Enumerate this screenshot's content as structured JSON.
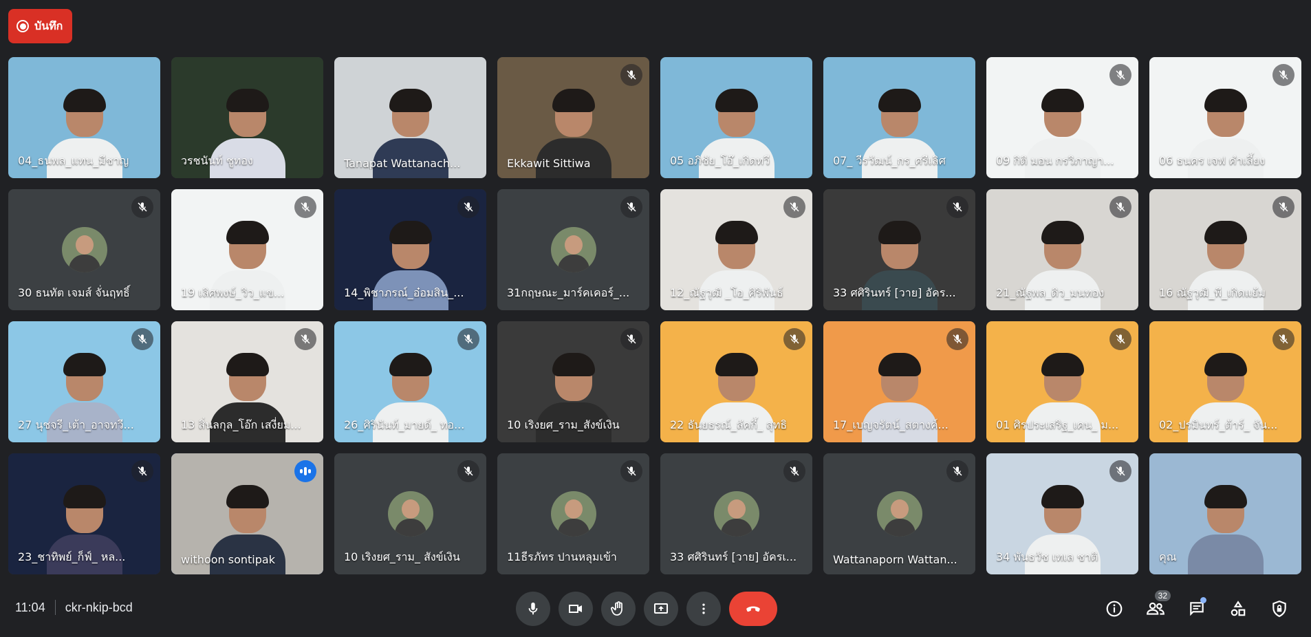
{
  "recording": {
    "label": "บันทึก"
  },
  "participants": [
    {
      "name": "04_ธนพล_แทน_มีชาญ",
      "muted": false,
      "kind": "video",
      "bg": "#7fb8d8",
      "shirt": "#eef0f0"
    },
    {
      "name": "วรชนันท์ ชูทอง",
      "muted": false,
      "kind": "video",
      "bg": "#2b3a2b",
      "shirt": "#d9dce6"
    },
    {
      "name": "Tanapat Wattanach...",
      "muted": false,
      "kind": "video",
      "bg": "#cfd3d6",
      "shirt": "#2f3b55"
    },
    {
      "name": "Ekkawit Sittiwa",
      "muted": true,
      "kind": "video",
      "bg": "#6a5a45",
      "shirt": "#2c2c2c"
    },
    {
      "name": "05 อภิชัย_โอ๊_เกิดทวี",
      "muted": false,
      "kind": "video",
      "bg": "#7fb8d8",
      "shirt": "#eef0f0"
    },
    {
      "name": "07_ วีรวัฒน์_กร_ศรีเลิศ",
      "muted": false,
      "kind": "video",
      "bg": "#7fb8d8",
      "shirt": "#eef0f0"
    },
    {
      "name": "09 กิติ มอน กรวิภาญา...",
      "muted": true,
      "kind": "video",
      "bg": "#f2f4f4",
      "shirt": "#eef0f0"
    },
    {
      "name": "06 ธนคร เจฟ คำเลี้ยง",
      "muted": true,
      "kind": "video",
      "bg": "#f2f4f4",
      "shirt": "#eef0f0"
    },
    {
      "name": "30 ธนทัต เจมส์ จั่นฤทธิ์",
      "muted": true,
      "kind": "avatar",
      "bg": "#3c4043"
    },
    {
      "name": "19 เลิศพงษ์_วิว_แข...",
      "muted": true,
      "kind": "video",
      "bg": "#f2f4f4",
      "shirt": "#eef0f0"
    },
    {
      "name": "14_พิชาภรณ์_อ๋อมสิน_...",
      "muted": true,
      "kind": "video",
      "bg": "#1a2440",
      "shirt": "#7d92b8"
    },
    {
      "name": "31กฤษณะ_มาร์คเคอร์_...",
      "muted": true,
      "kind": "avatar",
      "bg": "#3c4043"
    },
    {
      "name": "12_ณัฐวุฒิ _โอ_ศิริพันธ์",
      "muted": true,
      "kind": "video",
      "bg": "#e4e2de",
      "shirt": "#eef0f0"
    },
    {
      "name": "33 ศศิรินทร์ [วาย] อัคร...",
      "muted": true,
      "kind": "video",
      "bg": "#3a3a3a",
      "shirt": "#3a4a4f"
    },
    {
      "name": "21_ณัฐพล_ดิว_มนทอง",
      "muted": true,
      "kind": "video",
      "bg": "#d8d6d2",
      "shirt": "#eef0f0"
    },
    {
      "name": "16 ณัฐวุฒิ_พี_เกิดแย้ม",
      "muted": true,
      "kind": "video",
      "bg": "#d8d6d2",
      "shirt": "#eef0f0"
    },
    {
      "name": "27 นุชจรี_เต้า_อาจทวี...",
      "muted": true,
      "kind": "video",
      "bg": "#8cc7e6",
      "shirt": "#a8b3c9"
    },
    {
      "name": "13 สิ่นลกุล_โอ๊ก เสงี่ยม...",
      "muted": true,
      "kind": "video",
      "bg": "#e4e2de",
      "shirt": "#2c2c2c"
    },
    {
      "name": "26_ศิรินันท์_มายด์_ ทอ...",
      "muted": true,
      "kind": "video",
      "bg": "#8cc7e6",
      "shirt": "#eef0f0"
    },
    {
      "name": "10 เริงยศ_ราม_สังข์เงิน",
      "muted": true,
      "kind": "video",
      "bg": "#3a3a3a",
      "shirt": "#2c2c2c"
    },
    {
      "name": "22 ธันยธรณ์_ลัคกี้_ สุทธิ",
      "muted": true,
      "kind": "video",
      "bg": "#f4b24a",
      "shirt": "#eef0f0"
    },
    {
      "name": "17_เบญจรัตน์_สตางค์...",
      "muted": true,
      "kind": "video",
      "bg": "#f09a4a",
      "shirt": "#d7dbe4"
    },
    {
      "name": "01 ศิรประเสริฐ_เคน_ ม...",
      "muted": true,
      "kind": "video",
      "bg": "#f4b24a",
      "shirt": "#eef0f0"
    },
    {
      "name": "02_ปรมินทร์_ต้าร์_ จัน...",
      "muted": true,
      "kind": "video",
      "bg": "#f4b24a",
      "shirt": "#eef0f0"
    },
    {
      "name": "23_ชาทิพย์_ก็ฟ์_ หล...",
      "muted": true,
      "kind": "video",
      "bg": "#1a2440",
      "shirt": "#3b3b5a"
    },
    {
      "name": "withoon sontipak",
      "muted": false,
      "speaking": true,
      "kind": "video",
      "bg": "#b6b3ad",
      "shirt": "#2a3344"
    },
    {
      "name": "10 เริงยศ_ราม_ สังข์เงิน",
      "muted": true,
      "kind": "avatar",
      "bg": "#3c4043"
    },
    {
      "name": "11ธีรภัทร ปานหลุมเข้า",
      "muted": true,
      "kind": "avatar",
      "bg": "#3c4043"
    },
    {
      "name": "33 ศศิรินทร์ [วาย] อัครเ...",
      "muted": true,
      "kind": "avatar",
      "bg": "#3c4043"
    },
    {
      "name": "Wattanaporn Wattan...",
      "muted": true,
      "kind": "avatar",
      "bg": "#3c4043"
    },
    {
      "name": "34 พันธวัช เทเล ชาติ",
      "muted": true,
      "kind": "video",
      "bg": "#c9d6e2",
      "shirt": "#eef0f0"
    },
    {
      "name": "คุณ",
      "muted": false,
      "kind": "video",
      "bg": "#9bb8d3",
      "shirt": "#7a8aa6"
    }
  ],
  "footer": {
    "time": "11:04",
    "meeting_code": "ckr-nkip-bcd",
    "people_count": "32"
  },
  "icons": {
    "mic": "mic-icon",
    "camera": "camera-icon",
    "hand": "raise-hand-icon",
    "present": "present-screen-icon",
    "more": "more-options-icon",
    "end": "end-call-icon",
    "info": "info-icon",
    "people": "people-icon",
    "chat": "chat-icon",
    "activities": "activities-icon",
    "host": "host-controls-icon"
  },
  "colors": {
    "background": "#202124",
    "tile": "#3c4043",
    "record": "#d93025",
    "end_call": "#ea4335",
    "speaking": "#1a73e8"
  }
}
